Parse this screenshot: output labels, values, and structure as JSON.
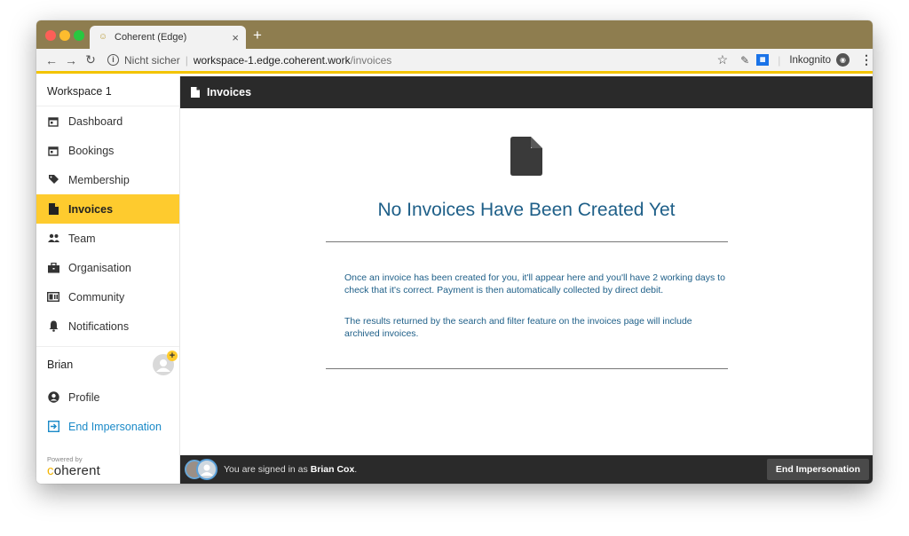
{
  "browser": {
    "tab_title": "Coherent (Edge)",
    "tab_close": "×",
    "new_tab": "+",
    "not_secure": "Nicht sicher",
    "url_host": "workspace-1.edge.coherent.work",
    "url_path": "/invoices",
    "incognito_label": "Inkognito"
  },
  "sidebar": {
    "workspace_title": "Workspace 1",
    "items": [
      {
        "label": "Dashboard",
        "icon": "calendar-icon"
      },
      {
        "label": "Bookings",
        "icon": "calendar-icon"
      },
      {
        "label": "Membership",
        "icon": "tag-icon"
      },
      {
        "label": "Invoices",
        "icon": "document-icon",
        "active": true
      },
      {
        "label": "Team",
        "icon": "people-icon"
      },
      {
        "label": "Organisation",
        "icon": "briefcase-icon"
      },
      {
        "label": "Community",
        "icon": "id-card-icon"
      },
      {
        "label": "Notifications",
        "icon": "bell-icon"
      }
    ],
    "user": {
      "name": "Brian",
      "profile_label": "Profile",
      "end_impersonation_label": "End Impersonation"
    },
    "powered_by": "Powered by",
    "brand": {
      "first": "c",
      "rest": "oherent"
    }
  },
  "header": {
    "title": "Invoices"
  },
  "main": {
    "empty_title": "No Invoices Have Been Created Yet",
    "paragraph_1": "Once an invoice has been created for you, it'll appear here and you'll have 2 working days to check that it's correct. Payment is then automatically collected by direct debit.",
    "paragraph_2": "The results returned by the search and filter feature on the invoices page will include archived invoices."
  },
  "footer": {
    "signed_in_prefix": "You are signed in as ",
    "signed_in_name": "Brian Cox",
    "signed_in_suffix": ".",
    "end_button": "End Impersonation"
  },
  "colors": {
    "accent": "#fecb2e",
    "dark": "#2a2a2a",
    "text_blue": "#1e5f88",
    "link_blue": "#1b8ac8"
  }
}
